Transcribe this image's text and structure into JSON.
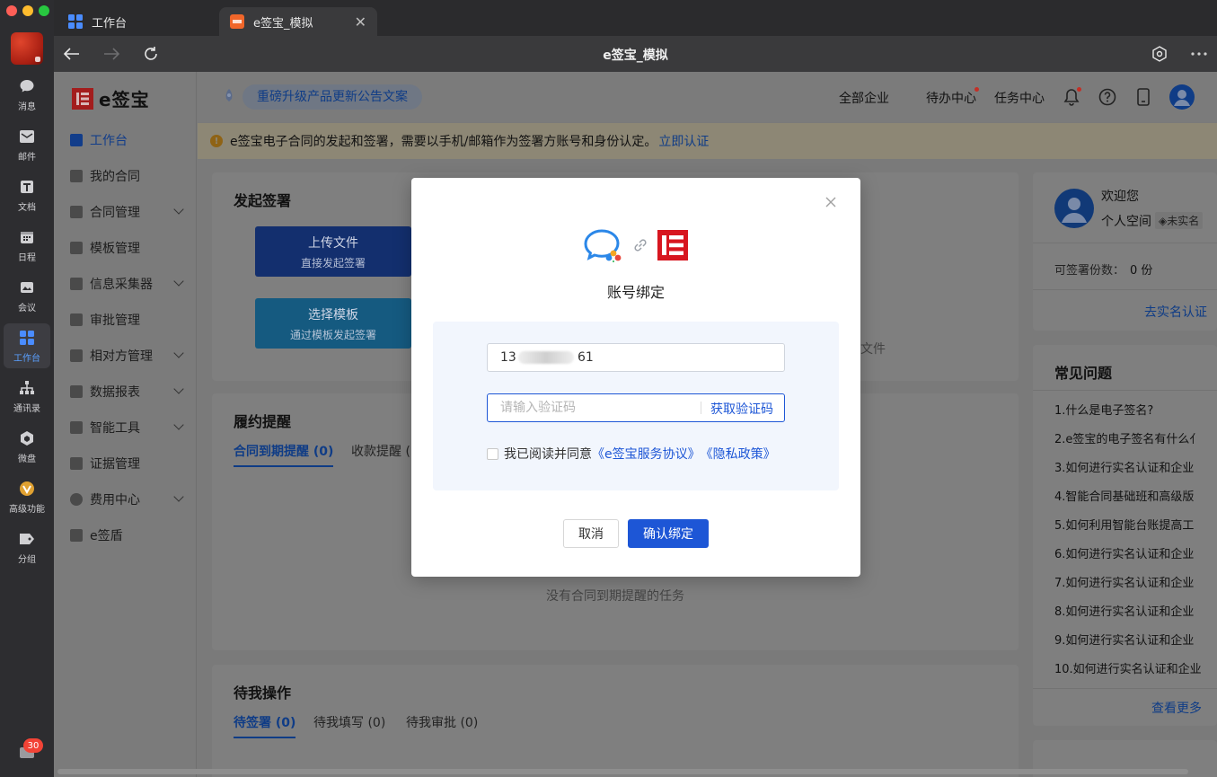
{
  "dock": {
    "items": [
      {
        "label": "消息",
        "icon": "chat-bubble-icon"
      },
      {
        "label": "邮件",
        "icon": "mail-icon"
      },
      {
        "label": "文档",
        "icon": "document-icon"
      },
      {
        "label": "日程",
        "icon": "calendar-icon"
      },
      {
        "label": "会议",
        "icon": "video-meeting-icon"
      },
      {
        "label": "工作台",
        "icon": "workbench-grid-icon"
      },
      {
        "label": "通讯录",
        "icon": "org-chart-icon"
      },
      {
        "label": "微盘",
        "icon": "cloud-drive-icon"
      },
      {
        "label": "高级功能",
        "icon": "premium-icon"
      },
      {
        "label": "分组",
        "icon": "tag-icon"
      }
    ],
    "badge": "30"
  },
  "browser": {
    "tabs": [
      {
        "label": "工作台"
      },
      {
        "label": "e签宝_模拟"
      }
    ],
    "title": "e签宝_模拟"
  },
  "app": {
    "logo_text": "e签宝",
    "menu": [
      {
        "label": "工作台"
      },
      {
        "label": "我的合同"
      },
      {
        "label": "合同管理"
      },
      {
        "label": "模板管理"
      },
      {
        "label": "信息采集器"
      },
      {
        "label": "审批管理"
      },
      {
        "label": "相对方管理"
      },
      {
        "label": "数据报表"
      },
      {
        "label": "智能工具"
      },
      {
        "label": "证据管理"
      },
      {
        "label": "费用中心"
      },
      {
        "label": "e签盾"
      }
    ],
    "announcement": "重磅升级产品更新公告文案",
    "top_links": {
      "all_companies": "全部企业",
      "todo_center": "待办中心",
      "task_center": "任务中心"
    },
    "notice": {
      "text": "e签宝电子合同的发起和签署，需要以手机/邮箱作为签署方账号和身份认定。",
      "link": "立即认证"
    },
    "start_sign": {
      "title": "发起签署",
      "upload": {
        "title": "上传文件",
        "sub": "直接发起签署"
      },
      "template": {
        "title": "选择模板",
        "sub": "通过模板发起签署"
      },
      "partial_right_text": "文件"
    },
    "reminder": {
      "title": "履约提醒",
      "tabs": [
        "合同到期提醒 (0)",
        "收款提醒 (("
      ],
      "empty": "没有合同到期提醒的任务"
    },
    "pending": {
      "title": "待我操作",
      "tabs": [
        "待签署 (0)",
        "待我填写 (0)",
        "待我审批 (0)"
      ]
    },
    "profile": {
      "welcome": "欢迎您",
      "space": "个人空间",
      "verify_badge": "未实名",
      "quota_label": "可签署份数：",
      "quota_value": "0 份",
      "verify_link": "去实名认证"
    },
    "faq": {
      "title": "常见问题",
      "items": [
        "1.什么是电子签名?",
        "2.e签宝的电子签名有什么亻",
        "3.如何进行实名认证和企业",
        "4.智能合同基础班和高级版",
        "5.如何利用智能台账提高工",
        "6.如何进行实名认证和企业",
        "7.如何进行实名认证和企业",
        "8.如何进行实名认证和企业",
        "9.如何进行实名认证和企业",
        "10.如何进行实名认证和企业"
      ],
      "more": "查看更多"
    }
  },
  "modal": {
    "title": "账号绑定",
    "phone_prefix": "13",
    "phone_suffix": "61",
    "code_placeholder": "请输入验证码",
    "get_code": "获取验证码",
    "agree_prefix": "我已阅读并同意",
    "agree_link1": "《e签宝服务协议》",
    "agree_link2": "《隐私政策》",
    "cancel": "取消",
    "confirm": "确认绑定"
  }
}
